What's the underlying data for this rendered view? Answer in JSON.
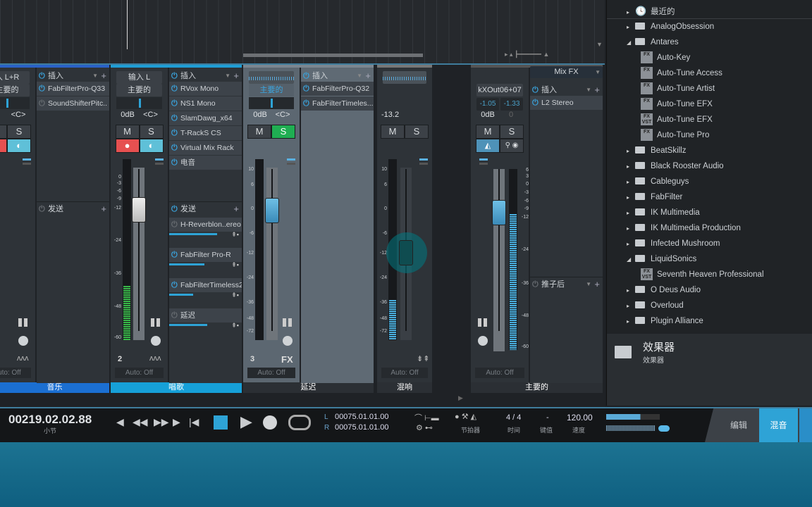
{
  "colors": {
    "accent": "#2ea3d6",
    "music_label": "#1b6fd2",
    "vocal_label": "#16a0d8",
    "solo_on": "#1fae52",
    "record": "#e65050",
    "monitor": "#5fc0d8",
    "meter_green": "#38b848",
    "meter_blue": "#4ab0e0"
  },
  "channels": [
    {
      "id": "music",
      "input": "入 L+R",
      "output": "主要的",
      "volume": "",
      "pan": "<C>",
      "mute": "M",
      "solo": "S",
      "number": "",
      "auto": "Auto: Off",
      "label": "音乐",
      "inserts_header": "插入",
      "inserts": [
        {
          "name": "FabFilterPro-Q33",
          "on": true
        },
        {
          "name": "SoundShifterPitc..",
          "on": false
        }
      ],
      "sends_header": "发送",
      "sends_on": false,
      "sends": []
    },
    {
      "id": "vocal",
      "input": "输入 L",
      "output": "主要的",
      "volume": "0dB",
      "pan": "<C>",
      "mute": "M",
      "solo": "S",
      "number": "2",
      "auto": "Auto: Off",
      "label": "唱歌",
      "meter_level": 0.3,
      "scale": [
        "0",
        "-3",
        "-6",
        "-9",
        "-12",
        "-24",
        "-36",
        "-48",
        "-60"
      ],
      "inserts_header": "插入",
      "inserts": [
        {
          "name": "RVox Mono",
          "on": true
        },
        {
          "name": "NS1 Mono",
          "on": true
        },
        {
          "name": "SlamDawg_x64",
          "on": true
        },
        {
          "name": "T-RackS CS",
          "on": true
        },
        {
          "name": "Virtual Mix Rack",
          "on": true
        },
        {
          "name": "电音",
          "on": true
        }
      ],
      "sends_header": "发送",
      "sends_on": true,
      "sends": [
        {
          "name": "H-Reverblon..ereo",
          "on": false,
          "level": 0.75
        },
        {
          "name": "FabFilter Pro-R",
          "on": true,
          "level": 0.55
        },
        {
          "name": "FabFilterTimeless2",
          "on": true,
          "level": 0.38
        },
        {
          "name": "延迟",
          "on": false,
          "level": 0.6
        }
      ]
    },
    {
      "id": "delay",
      "input": "",
      "output": "主要的",
      "volume": "0dB",
      "pan": "<C>",
      "mute": "M",
      "solo": "S",
      "number": "3",
      "fx_badge": "FX",
      "auto": "Auto: Off",
      "label": "延迟",
      "meter_level": 0,
      "scale": [
        "10",
        "6",
        "0",
        "-6",
        "-12",
        "-24",
        "-36",
        "-48",
        "-72"
      ],
      "inserts_header": "插入",
      "inserts": [
        {
          "name": "FabFilterPro-Q32",
          "on": true
        },
        {
          "name": "FabFilterTimeles...",
          "on": true
        }
      ]
    },
    {
      "id": "reverb",
      "volume": "-13.2",
      "mute": "M",
      "solo": "S",
      "auto": "Auto: Off",
      "label": "混响",
      "meter_level": 0.22,
      "scale": [
        "10",
        "6",
        "0",
        "-6",
        "-12",
        "-24",
        "-36",
        "-48",
        "-72"
      ]
    },
    {
      "id": "main",
      "output": "kXOut06+07",
      "peak_l": "-1.05",
      "peak_r": "-1.33",
      "volume": "0dB",
      "pan": "0",
      "mute": "M",
      "solo": "S",
      "auto": "Auto: Off",
      "label": "主要的",
      "meter_level": 0.75,
      "scale": [
        "6",
        "3",
        "0",
        "-3",
        "-6",
        "-9",
        "-12",
        "-24",
        "-36",
        "-48",
        "-60"
      ],
      "mixfx": "Mix FX",
      "inserts_header": "插入",
      "inserts": [
        {
          "name": "L2 Stereo",
          "on": true
        }
      ],
      "post_header": "推子后"
    }
  ],
  "browser": {
    "items": [
      {
        "label": "最近的",
        "type": "recent",
        "level": 0,
        "expanded": false
      },
      {
        "label": "AnalogObsession",
        "type": "folder",
        "level": 0,
        "expanded": false
      },
      {
        "label": "Antares",
        "type": "folder",
        "level": 0,
        "expanded": true
      },
      {
        "label": "Auto-Key",
        "type": "fx",
        "level": 1,
        "badge": "FX"
      },
      {
        "label": "Auto-Tune Access",
        "type": "fx",
        "level": 1,
        "badge": "FX"
      },
      {
        "label": "Auto-Tune Artist",
        "type": "fx",
        "level": 1,
        "badge": "FX"
      },
      {
        "label": "Auto-Tune EFX",
        "type": "fx",
        "level": 1,
        "badge": "FX"
      },
      {
        "label": "Auto-Tune EFX",
        "type": "fx",
        "level": 1,
        "badge": "FX VST"
      },
      {
        "label": "Auto-Tune Pro",
        "type": "fx",
        "level": 1,
        "badge": "FX"
      },
      {
        "label": "BeatSkillz",
        "type": "folder",
        "level": 0,
        "expanded": false
      },
      {
        "label": "Black Rooster Audio",
        "type": "folder",
        "level": 0,
        "expanded": false
      },
      {
        "label": "Cableguys",
        "type": "folder",
        "level": 0,
        "expanded": false
      },
      {
        "label": "FabFilter",
        "type": "folder",
        "level": 0,
        "expanded": false
      },
      {
        "label": "IK Multimedia",
        "type": "folder",
        "level": 0,
        "expanded": false
      },
      {
        "label": "IK Multimedia Production",
        "type": "folder",
        "level": 0,
        "expanded": false
      },
      {
        "label": "Infected Mushroom",
        "type": "folder",
        "level": 0,
        "expanded": false
      },
      {
        "label": "LiquidSonics",
        "type": "folder",
        "level": 0,
        "expanded": true
      },
      {
        "label": "Seventh Heaven Professional",
        "type": "fx",
        "level": 1,
        "badge": "FX VST"
      },
      {
        "label": "O Deus Audio",
        "type": "folder",
        "level": 0,
        "expanded": false
      },
      {
        "label": "Overloud",
        "type": "folder",
        "level": 0,
        "expanded": false
      },
      {
        "label": "Plugin Alliance",
        "type": "folder",
        "level": 0,
        "expanded": false
      }
    ],
    "info_title": "效果器",
    "info_subtitle": "效果器"
  },
  "transport": {
    "position": "00219.02.02.88",
    "position_unit": "小节",
    "loop_l_label": "L",
    "loop_l": "00075.01.01.00",
    "loop_r_label": "R",
    "loop_r": "00075.01.01.00",
    "metronome": "节拍器",
    "time_sig": "4 / 4",
    "time_sig_label": "时间",
    "key": "-",
    "key_label": "键值",
    "tempo": "120.00",
    "tempo_label": "速度",
    "edit_tab": "编辑",
    "mix_tab": "混音",
    "active_tab": "mix"
  }
}
